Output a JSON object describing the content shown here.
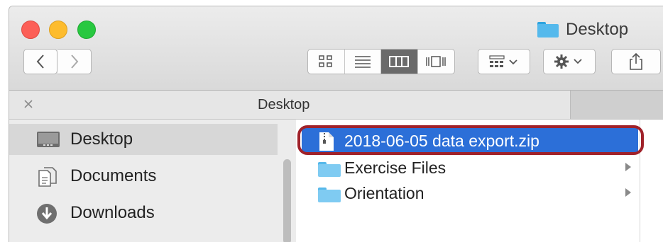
{
  "window": {
    "title": "Desktop",
    "folder_icon": "folder-icon"
  },
  "toolbar": {
    "back_icon": "chevron-left-icon",
    "forward_icon": "chevron-right-icon",
    "view_modes": [
      "icon-view",
      "list-view",
      "column-view",
      "cover-flow-view"
    ],
    "active_view": "column-view",
    "group_icon": "group-by-icon",
    "action_icon": "gear-icon",
    "share_icon": "share-icon"
  },
  "pathbar": {
    "close_icon": "close-icon",
    "title": "Desktop"
  },
  "sidebar": {
    "items": [
      {
        "label": "Desktop",
        "icon": "desktop-icon",
        "selected": true
      },
      {
        "label": "Documents",
        "icon": "documents-icon",
        "selected": false
      },
      {
        "label": "Downloads",
        "icon": "downloads-icon",
        "selected": false
      }
    ]
  },
  "files": [
    {
      "name": "2018-06-05 data export.zip",
      "icon": "zip-file-icon",
      "selected": true,
      "has_children": false
    },
    {
      "name": "Exercise Files",
      "icon": "folder-icon",
      "selected": false,
      "has_children": true
    },
    {
      "name": "Orientation",
      "icon": "folder-icon",
      "selected": false,
      "has_children": true
    }
  ],
  "colors": {
    "selection": "#2c6fd8",
    "highlight_ring": "#a0222a",
    "folder": "#7fcbf2"
  }
}
